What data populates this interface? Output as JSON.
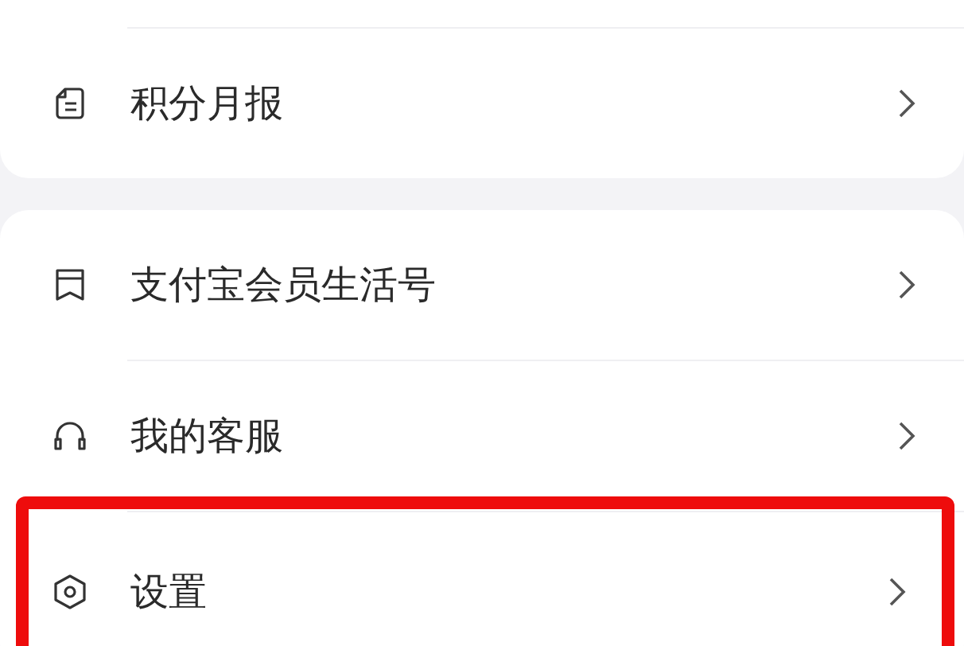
{
  "groups": [
    {
      "items": [
        {
          "label": "积分月报",
          "highlighted": false
        }
      ]
    },
    {
      "items": [
        {
          "label": "支付宝会员生活号",
          "highlighted": false
        },
        {
          "label": "我的客服",
          "highlighted": false
        },
        {
          "label": "设置",
          "highlighted": true
        }
      ]
    }
  ]
}
